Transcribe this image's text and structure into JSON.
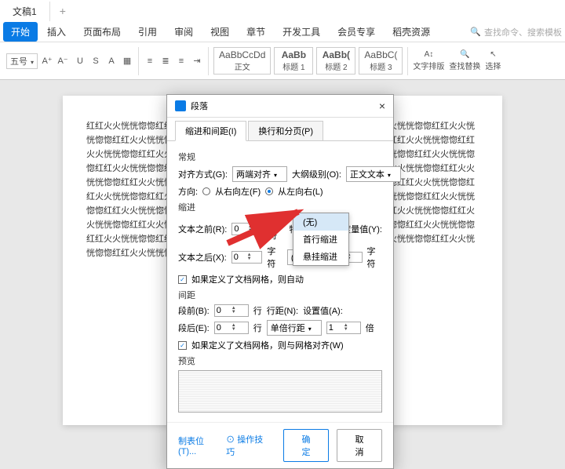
{
  "titlebar": {
    "tab": "文稿1",
    "add": "+"
  },
  "ribbon_tabs": [
    "开始",
    "插入",
    "页面布局",
    "引用",
    "审阅",
    "视图",
    "章节",
    "开发工具",
    "会员专享",
    "稻壳资源"
  ],
  "search_placeholder": "查找命令、搜索模板",
  "font": {
    "size": "五号"
  },
  "styles": [
    {
      "preview": "AaBbCcDd",
      "name": "正文"
    },
    {
      "preview": "AaBb",
      "name": "标题 1"
    },
    {
      "preview": "AaBb(",
      "name": "标题 2"
    },
    {
      "preview": "AaBbC(",
      "name": "标题 3"
    }
  ],
  "ribbon_right": {
    "text_layout": "文字排版",
    "find_replace": "查找替换",
    "select": "选择"
  },
  "doc_text": "红红火火恍恍惚惚红红火火恍恍惚惚红红火火恍恍惚惚红红火火恍恍惚惚红红火火恍恍惚惚红红火火恍恍惚惚红红火火恍恍惚惚红红火火恍恍惚惚红红火火恍恍惚惚红红火火恍恍惚惚红红火火恍恍惚惚红红火火恍恍惚惚红红火火恍恍惚惚红红火火恍恍惚惚红红火火恍恍惚惚红红火火恍恍惚惚红红火火恍恍惚惚红红火火恍恍惚惚红红火火恍恍惚惚红红火火恍恍惚惚红红火火恍恍惚惚红红火火恍恍惚惚红红火火恍恍惚惚红红火火恍恍惚惚红红火火恍恍惚惚红红火火恍恍惚惚红红火火恍恍惚惚红红火火恍恍惚惚红红火火恍恍惚惚红红火火恍恍惚惚红红火火恍恍惚惚红红火火恍恍惚惚红红火火恍恍惚惚红红火火恍恍惚惚红红火火恍恍惚惚红红火火恍恍惚惚红红火火恍恍惚惚红红火火恍恍惚惚红红火火恍恍惚惚红红火火恍恍惚惚红红火火恍恍惚惚红红火火恍恍惚惚红红火火恍恍惚惚红红火火恍恍惚惚红红火火恍恍惚惚红红火火恍恍惚惚红红火火恍恍惚惚红红火火恍恍惚惚红红火火恍恍惚惚红红火火恍恍惚惚红红火火恍恍惚惚红红火火恍恍惚惚红红火火恍恍惚惚红红火火恍恍惚惚红红火火恍恍惚惚",
  "dialog": {
    "title": "段落",
    "tabs": {
      "active": "缩进和间距(I)",
      "other": "换行和分页(P)"
    },
    "general": {
      "label": "常规",
      "align_label": "对齐方式(G):",
      "align_value": "两端对齐",
      "outline_label": "大纲级别(O):",
      "outline_value": "正文文本",
      "direction_label": "方向:",
      "rtl": "从右向左(F)",
      "ltr": "从左向右(L)"
    },
    "indent": {
      "label": "缩进",
      "before_label": "文本之前(R):",
      "before_val": "0",
      "unit1": "字符",
      "after_label": "文本之后(X):",
      "after_val": "0",
      "unit2": "字符",
      "special_label": "特殊格式(S):",
      "special_val": "(无)",
      "measure_label": "度量值(Y):",
      "measure_unit": "字符",
      "grid_check": "如果定义了文档网格，则自动",
      "dropdown_opts": [
        "(无)",
        "首行缩进",
        "悬挂缩进"
      ]
    },
    "spacing": {
      "label": "间距",
      "before_label": "段前(B):",
      "before_val": "0",
      "unit1": "行",
      "after_label": "段后(E):",
      "after_val": "0",
      "unit2": "行",
      "line_label": "行距(N):",
      "line_val": "单倍行距",
      "setval_label": "设置值(A):",
      "setval_val": "1",
      "setval_unit": "倍",
      "grid_check": "如果定义了文档网格，则与网格对齐(W)"
    },
    "preview_label": "预览",
    "footer": {
      "tabstops": "制表位(T)...",
      "tips": "操作技巧",
      "ok": "确定",
      "cancel": "取消"
    }
  }
}
